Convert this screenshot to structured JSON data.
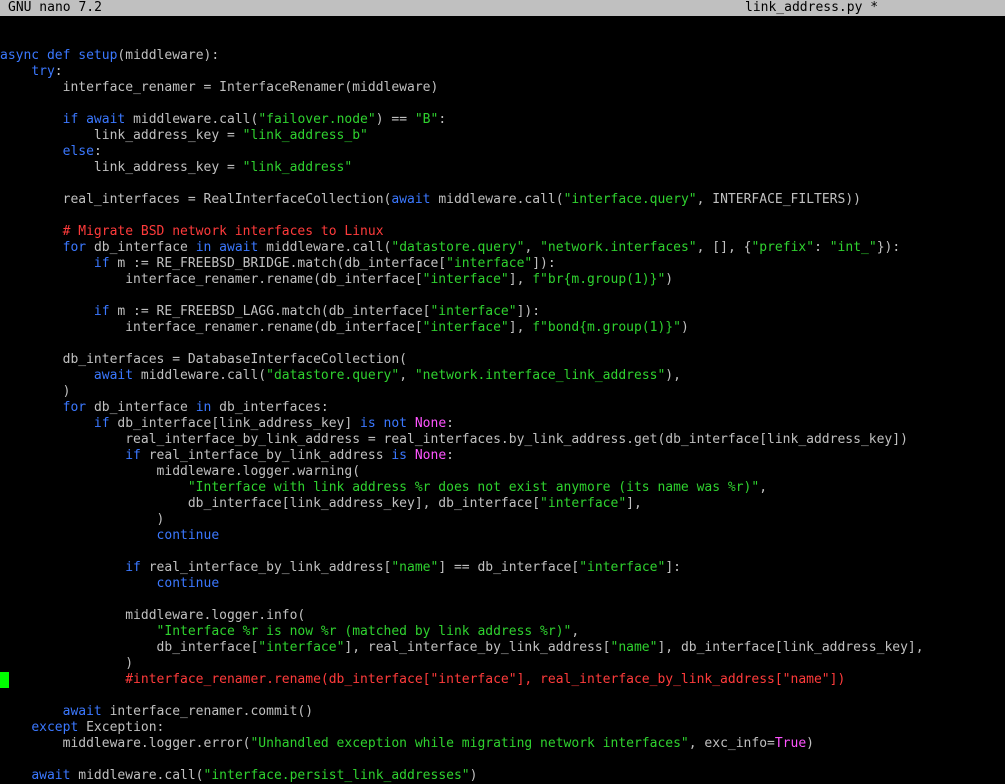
{
  "titlebar": {
    "app": "GNU nano 7.2",
    "filename": "link_address.py *"
  },
  "lines": [
    {
      "indent": 0,
      "tokens": []
    },
    {
      "indent": 0,
      "tokens": [
        {
          "t": "kw",
          "v": "async def "
        },
        {
          "t": "fn",
          "v": "setup"
        },
        {
          "t": "tx",
          "v": "(middleware):"
        }
      ]
    },
    {
      "indent": 4,
      "tokens": [
        {
          "t": "kw",
          "v": "try"
        },
        {
          "t": "tx",
          "v": ":"
        }
      ]
    },
    {
      "indent": 8,
      "tokens": [
        {
          "t": "tx",
          "v": "interface_renamer = InterfaceRenamer(middleware)"
        }
      ]
    },
    {
      "indent": 0,
      "tokens": []
    },
    {
      "indent": 8,
      "tokens": [
        {
          "t": "kw",
          "v": "if await "
        },
        {
          "t": "tx",
          "v": "middleware.call("
        },
        {
          "t": "str",
          "v": "\"failover.node\""
        },
        {
          "t": "tx",
          "v": ") == "
        },
        {
          "t": "str",
          "v": "\"B\""
        },
        {
          "t": "tx",
          "v": ":"
        }
      ]
    },
    {
      "indent": 12,
      "tokens": [
        {
          "t": "tx",
          "v": "link_address_key = "
        },
        {
          "t": "str",
          "v": "\"link_address_b\""
        }
      ]
    },
    {
      "indent": 8,
      "tokens": [
        {
          "t": "kw",
          "v": "else"
        },
        {
          "t": "tx",
          "v": ":"
        }
      ]
    },
    {
      "indent": 12,
      "tokens": [
        {
          "t": "tx",
          "v": "link_address_key = "
        },
        {
          "t": "str",
          "v": "\"link_address\""
        }
      ]
    },
    {
      "indent": 0,
      "tokens": []
    },
    {
      "indent": 8,
      "tokens": [
        {
          "t": "tx",
          "v": "real_interfaces = RealInterfaceCollection("
        },
        {
          "t": "kw",
          "v": "await "
        },
        {
          "t": "tx",
          "v": "middleware.call("
        },
        {
          "t": "str",
          "v": "\"interface.query\""
        },
        {
          "t": "tx",
          "v": ", INTERFACE_FILTERS))"
        }
      ]
    },
    {
      "indent": 0,
      "tokens": []
    },
    {
      "indent": 8,
      "tokens": [
        {
          "t": "cm",
          "v": "# Migrate BSD network interfaces to Linux"
        }
      ]
    },
    {
      "indent": 8,
      "tokens": [
        {
          "t": "kw",
          "v": "for "
        },
        {
          "t": "tx",
          "v": "db_interface "
        },
        {
          "t": "kw",
          "v": "in await "
        },
        {
          "t": "tx",
          "v": "middleware.call("
        },
        {
          "t": "str",
          "v": "\"datastore.query\""
        },
        {
          "t": "tx",
          "v": ", "
        },
        {
          "t": "str",
          "v": "\"network.interfaces\""
        },
        {
          "t": "tx",
          "v": ", [], {"
        },
        {
          "t": "str",
          "v": "\"prefix\""
        },
        {
          "t": "tx",
          "v": ": "
        },
        {
          "t": "str",
          "v": "\"int_\""
        },
        {
          "t": "tx",
          "v": "}):"
        }
      ]
    },
    {
      "indent": 12,
      "tokens": [
        {
          "t": "kw",
          "v": "if "
        },
        {
          "t": "tx",
          "v": "m := RE_FREEBSD_BRIDGE.match(db_interface["
        },
        {
          "t": "str",
          "v": "\"interface\""
        },
        {
          "t": "tx",
          "v": "]):"
        }
      ]
    },
    {
      "indent": 16,
      "tokens": [
        {
          "t": "tx",
          "v": "interface_renamer.rename(db_interface["
        },
        {
          "t": "str",
          "v": "\"interface\""
        },
        {
          "t": "tx",
          "v": "], "
        },
        {
          "t": "str",
          "v": "f\"br{m.group(1)}\""
        },
        {
          "t": "tx",
          "v": ")"
        }
      ]
    },
    {
      "indent": 0,
      "tokens": []
    },
    {
      "indent": 12,
      "tokens": [
        {
          "t": "kw",
          "v": "if "
        },
        {
          "t": "tx",
          "v": "m := RE_FREEBSD_LAGG.match(db_interface["
        },
        {
          "t": "str",
          "v": "\"interface\""
        },
        {
          "t": "tx",
          "v": "]):"
        }
      ]
    },
    {
      "indent": 16,
      "tokens": [
        {
          "t": "tx",
          "v": "interface_renamer.rename(db_interface["
        },
        {
          "t": "str",
          "v": "\"interface\""
        },
        {
          "t": "tx",
          "v": "], "
        },
        {
          "t": "str",
          "v": "f\"bond{m.group(1)}\""
        },
        {
          "t": "tx",
          "v": ")"
        }
      ]
    },
    {
      "indent": 0,
      "tokens": []
    },
    {
      "indent": 8,
      "tokens": [
        {
          "t": "tx",
          "v": "db_interfaces = DatabaseInterfaceCollection("
        }
      ]
    },
    {
      "indent": 12,
      "tokens": [
        {
          "t": "kw",
          "v": "await "
        },
        {
          "t": "tx",
          "v": "middleware.call("
        },
        {
          "t": "str",
          "v": "\"datastore.query\""
        },
        {
          "t": "tx",
          "v": ", "
        },
        {
          "t": "str",
          "v": "\"network.interface_link_address\""
        },
        {
          "t": "tx",
          "v": "),"
        }
      ]
    },
    {
      "indent": 8,
      "tokens": [
        {
          "t": "tx",
          "v": ")"
        }
      ]
    },
    {
      "indent": 8,
      "tokens": [
        {
          "t": "kw",
          "v": "for "
        },
        {
          "t": "tx",
          "v": "db_interface "
        },
        {
          "t": "kw",
          "v": "in "
        },
        {
          "t": "tx",
          "v": "db_interfaces:"
        }
      ]
    },
    {
      "indent": 12,
      "tokens": [
        {
          "t": "kw",
          "v": "if "
        },
        {
          "t": "tx",
          "v": "db_interface[link_address_key] "
        },
        {
          "t": "kw",
          "v": "is not "
        },
        {
          "t": "pk",
          "v": "None"
        },
        {
          "t": "tx",
          "v": ":"
        }
      ]
    },
    {
      "indent": 16,
      "tokens": [
        {
          "t": "tx",
          "v": "real_interface_by_link_address = real_interfaces.by_link_address.get(db_interface[link_address_key])"
        }
      ]
    },
    {
      "indent": 16,
      "tokens": [
        {
          "t": "kw",
          "v": "if "
        },
        {
          "t": "tx",
          "v": "real_interface_by_link_address "
        },
        {
          "t": "kw",
          "v": "is "
        },
        {
          "t": "pk",
          "v": "None"
        },
        {
          "t": "tx",
          "v": ":"
        }
      ]
    },
    {
      "indent": 20,
      "tokens": [
        {
          "t": "tx",
          "v": "middleware.logger.warning("
        }
      ]
    },
    {
      "indent": 24,
      "tokens": [
        {
          "t": "str",
          "v": "\"Interface with link address %r does not exist anymore (its name was %r)\""
        },
        {
          "t": "tx",
          "v": ","
        }
      ]
    },
    {
      "indent": 24,
      "tokens": [
        {
          "t": "tx",
          "v": "db_interface[link_address_key], db_interface["
        },
        {
          "t": "str",
          "v": "\"interface\""
        },
        {
          "t": "tx",
          "v": "],"
        }
      ]
    },
    {
      "indent": 20,
      "tokens": [
        {
          "t": "tx",
          "v": ")"
        }
      ]
    },
    {
      "indent": 20,
      "tokens": [
        {
          "t": "kw",
          "v": "continue"
        }
      ]
    },
    {
      "indent": 0,
      "tokens": []
    },
    {
      "indent": 16,
      "tokens": [
        {
          "t": "kw",
          "v": "if "
        },
        {
          "t": "tx",
          "v": "real_interface_by_link_address["
        },
        {
          "t": "str",
          "v": "\"name\""
        },
        {
          "t": "tx",
          "v": "] == db_interface["
        },
        {
          "t": "str",
          "v": "\"interface\""
        },
        {
          "t": "tx",
          "v": "]:"
        }
      ]
    },
    {
      "indent": 20,
      "tokens": [
        {
          "t": "kw",
          "v": "continue"
        }
      ]
    },
    {
      "indent": 0,
      "tokens": []
    },
    {
      "indent": 16,
      "tokens": [
        {
          "t": "tx",
          "v": "middleware.logger.info("
        }
      ]
    },
    {
      "indent": 20,
      "tokens": [
        {
          "t": "str",
          "v": "\"Interface %r is now %r (matched by link address %r)\""
        },
        {
          "t": "tx",
          "v": ","
        }
      ]
    },
    {
      "indent": 20,
      "tokens": [
        {
          "t": "tx",
          "v": "db_interface["
        },
        {
          "t": "str",
          "v": "\"interface\""
        },
        {
          "t": "tx",
          "v": "], real_interface_by_link_address["
        },
        {
          "t": "str",
          "v": "\"name\""
        },
        {
          "t": "tx",
          "v": "], db_interface[link_address_key],"
        }
      ]
    },
    {
      "indent": 16,
      "tokens": [
        {
          "t": "tx",
          "v": ")"
        }
      ]
    },
    {
      "indent": 16,
      "tokens": [
        {
          "t": "cm",
          "v": "#interface_renamer.rename(db_interface[\"interface\"], real_interface_by_link_address[\"name\"])"
        }
      ]
    },
    {
      "indent": 0,
      "tokens": []
    },
    {
      "indent": 8,
      "tokens": [
        {
          "t": "kw",
          "v": "await "
        },
        {
          "t": "tx",
          "v": "interface_renamer.commit()"
        }
      ]
    },
    {
      "indent": 4,
      "tokens": [
        {
          "t": "kw",
          "v": "except "
        },
        {
          "t": "tx",
          "v": "Exception:"
        }
      ]
    },
    {
      "indent": 8,
      "tokens": [
        {
          "t": "tx",
          "v": "middleware.logger.error("
        },
        {
          "t": "str",
          "v": "\"Unhandled exception while migrating network interfaces\""
        },
        {
          "t": "tx",
          "v": ", exc_info="
        },
        {
          "t": "pk",
          "v": "True"
        },
        {
          "t": "tx",
          "v": ")"
        }
      ]
    },
    {
      "indent": 0,
      "tokens": []
    },
    {
      "indent": 4,
      "tokens": [
        {
          "t": "kw",
          "v": "await "
        },
        {
          "t": "tx",
          "v": "middleware.call("
        },
        {
          "t": "str",
          "v": "\"interface.persist_link_addresses\""
        },
        {
          "t": "tx",
          "v": ")"
        }
      ]
    }
  ],
  "colors": {
    "background": "#000000",
    "titlebar": "#c0c0c0",
    "keyword": "#3b78ff",
    "string": "#2fd22f",
    "comment": "#ff3b3b",
    "constant": "#ff55ff",
    "text": "#c0c0c0",
    "cursor": "#00ff00"
  }
}
